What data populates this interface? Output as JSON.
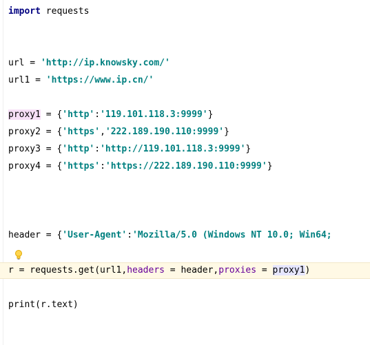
{
  "code": {
    "line_import": {
      "keyword": "import",
      "rest": " requests"
    },
    "line_url": {
      "var": "url",
      "eq": " = ",
      "str": "'http://ip.knowsky.com/'"
    },
    "line_url1": {
      "var": "url1",
      "eq": " = ",
      "str": "'https://www.ip.cn/'"
    },
    "line_proxy1": {
      "var": "proxy1",
      "pre": " = {",
      "key": "'http'",
      "mid": ":",
      "val": "'119.101.118.3:9999'",
      "post": "}"
    },
    "line_proxy2": {
      "var": "proxy2",
      "pre": " = {",
      "key": "'https'",
      "mid": ",",
      "val": "'222.189.190.110:9999'",
      "post": "}"
    },
    "line_proxy3": {
      "var": "proxy3",
      "pre": " = {",
      "key": "'http'",
      "mid": ":",
      "val": "'http://119.101.118.3:9999'",
      "post": "}"
    },
    "line_proxy4": {
      "var": "proxy4",
      "pre": " = {",
      "key": "'https'",
      "mid": ":",
      "val": "'https://222.189.190.110:9999'",
      "post": "}"
    },
    "line_header": {
      "var": "header",
      "pre": " = {",
      "key": "'User-Agent'",
      "mid": ":",
      "val": "'Mozilla/5.0 (Windows NT 10.0; Win64;"
    },
    "line_request": {
      "pre": "r = requests.get(url1,",
      "param1": "headers",
      "mid1": " = header,",
      "param2": "proxies",
      "mid2": " = ",
      "ref": "proxy1",
      "post": ")"
    },
    "line_print": {
      "text": "print(r.text)"
    }
  },
  "icons": {
    "intention_bulb": "lightbulb-icon"
  },
  "colors": {
    "keyword": "#000080",
    "string": "#008080",
    "parameter": "#660099",
    "current_line": "#fff9e5",
    "variable_highlight": "#f7dff7",
    "reference_highlight": "#e6e6ff"
  }
}
